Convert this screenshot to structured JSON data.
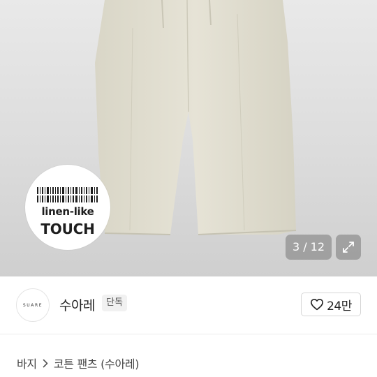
{
  "gallery": {
    "badge": {
      "line1": "linen-like",
      "line2": "TOUCH"
    },
    "counter": {
      "current": 3,
      "total": 12,
      "text": "3 / 12"
    },
    "expand_icon": "expand-icon"
  },
  "seller": {
    "logo_text": "SUARE",
    "name": "수아레",
    "tag": "단독",
    "like_icon": "heart-icon",
    "like_count": "24만"
  },
  "breadcrumb": {
    "items": [
      "바지",
      "코튼 팬츠 (수아레)"
    ],
    "separator_icon": "chevron-right-icon"
  },
  "colors": {
    "product_fabric": "#e3e0d2",
    "overlay": "#7a7a7a",
    "text_primary": "#222222"
  }
}
